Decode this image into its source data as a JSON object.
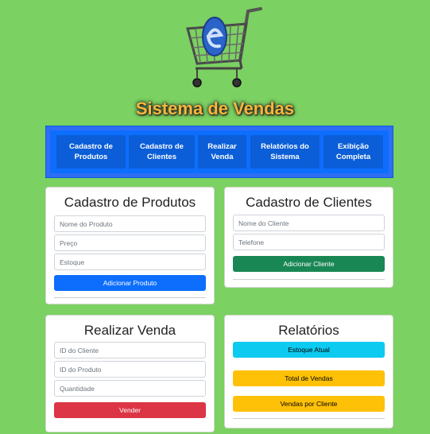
{
  "app": {
    "title": "Sistema de Vendas"
  },
  "nav": {
    "items": [
      {
        "label": "Cadastro de Produtos"
      },
      {
        "label": "Cadastro de Clientes"
      },
      {
        "label": "Realizar Venda"
      },
      {
        "label": "Relatórios do Sistema"
      },
      {
        "label": "Exibição Completa"
      }
    ]
  },
  "produtos": {
    "heading": "Cadastro de Produtos",
    "nome_placeholder": "Nome do Produto",
    "preco_placeholder": "Preço",
    "estoque_placeholder": "Estoque",
    "button": "Adicionar Produto"
  },
  "clientes": {
    "heading": "Cadastro de Clientes",
    "nome_placeholder": "Nome do Cliente",
    "telefone_placeholder": "Telefone",
    "button": "Adicionar Cliente"
  },
  "venda": {
    "heading": "Realizar Venda",
    "cliente_placeholder": "ID do Cliente",
    "produto_placeholder": "ID do Produto",
    "quantidade_placeholder": "Quantidade",
    "button": "Vender"
  },
  "relatorios": {
    "heading": "Relatórios",
    "estoque_button": "Estoque Atual",
    "total_button": "Total de Vendas",
    "cliente_button": "Vendas por Cliente"
  },
  "colors": {
    "background": "#7bd161",
    "primary": "#0d6efd",
    "success": "#198754",
    "danger": "#dc3545",
    "info": "#0dcaf0",
    "warning": "#ffc107",
    "title": "#f6b73c"
  },
  "icons": {
    "logo": "shopping-cart-e-icon"
  }
}
